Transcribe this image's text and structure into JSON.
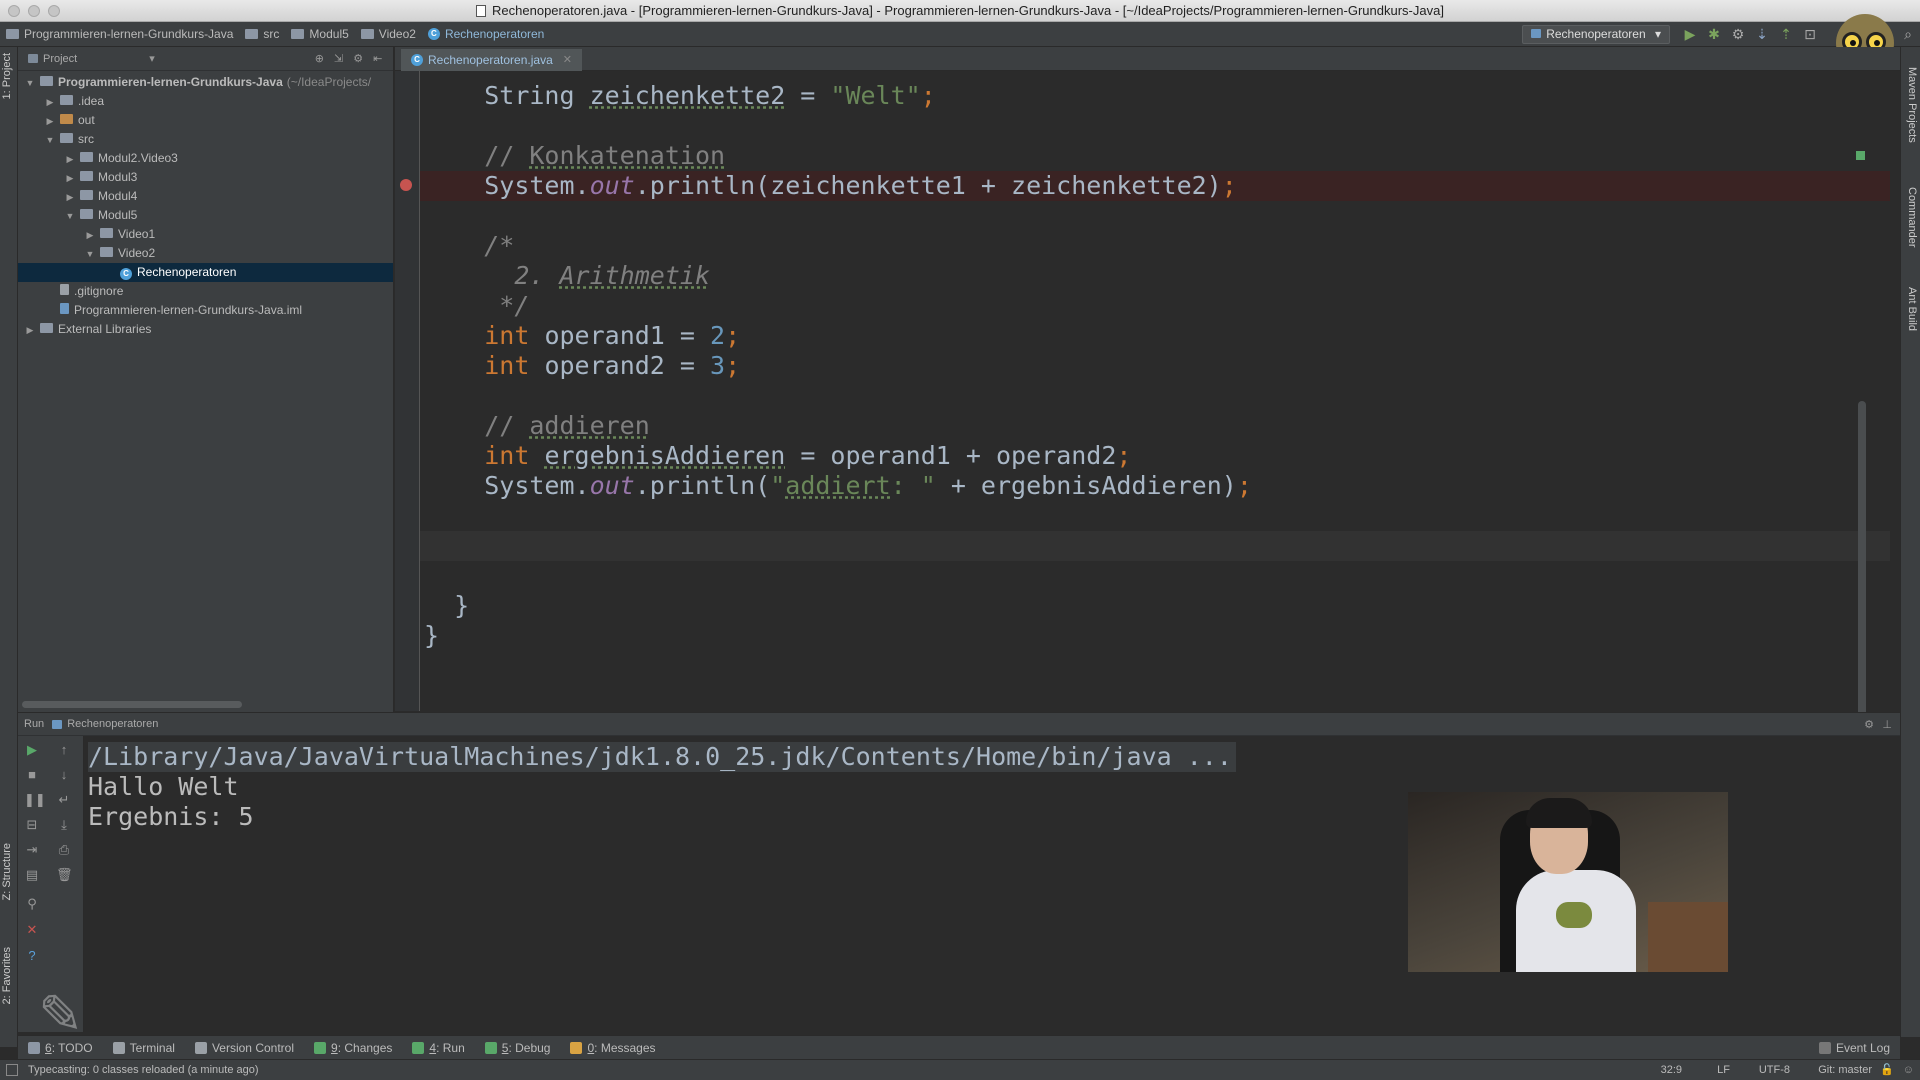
{
  "window": {
    "title": "Rechenoperatoren.java - [Programmieren-lernen-Grundkurs-Java] - Programmieren-lernen-Grundkurs-Java - [~/IdeaProjects/Programmieren-lernen-Grundkurs-Java]"
  },
  "breadcrumbs": [
    {
      "label": "Programmieren-lernen-Grundkurs-Java",
      "icon": "folder-icon"
    },
    {
      "label": "src",
      "icon": "folder-icon"
    },
    {
      "label": "Modul5",
      "icon": "folder-icon"
    },
    {
      "label": "Video2",
      "icon": "folder-icon"
    },
    {
      "label": "Rechenoperatoren",
      "icon": "class-icon"
    }
  ],
  "toolbar": {
    "run_config": "Rechenoperatoren",
    "run_config_arrow": "▾"
  },
  "left_stripe": {
    "project": "1: Project",
    "structure": "Z: Structure",
    "favorites": "2: Favorites"
  },
  "right_stripe": {
    "maven": "Maven Projects",
    "commander": "Commander",
    "ant": "Ant Build"
  },
  "project_panel": {
    "header": "Project",
    "tree": [
      {
        "label": "Programmieren-lernen-Grundkurs-Java",
        "suffix": "(~/IdeaProjects/",
        "arrow": "▼",
        "indent": 0,
        "icon": "module-icon"
      },
      {
        "label": ".idea",
        "arrow": "▶",
        "indent": 1,
        "icon": "folder-icon"
      },
      {
        "label": "out",
        "arrow": "▶",
        "indent": 1,
        "icon": "folder-orange-icon"
      },
      {
        "label": "src",
        "arrow": "▼",
        "indent": 1,
        "icon": "folder-icon"
      },
      {
        "label": "Modul2.Video3",
        "arrow": "▶",
        "indent": 2,
        "icon": "package-icon"
      },
      {
        "label": "Modul3",
        "arrow": "▶",
        "indent": 2,
        "icon": "package-icon"
      },
      {
        "label": "Modul4",
        "arrow": "▶",
        "indent": 2,
        "icon": "package-icon"
      },
      {
        "label": "Modul5",
        "arrow": "▼",
        "indent": 2,
        "icon": "package-icon"
      },
      {
        "label": "Video1",
        "arrow": "▶",
        "indent": 3,
        "icon": "package-icon"
      },
      {
        "label": "Video2",
        "arrow": "▼",
        "indent": 3,
        "icon": "package-icon"
      },
      {
        "label": "Rechenoperatoren",
        "arrow": "",
        "indent": 4,
        "icon": "class-icon",
        "selected": true
      },
      {
        "label": ".gitignore",
        "arrow": "",
        "indent": 1,
        "icon": "file-icon"
      },
      {
        "label": "Programmieren-lernen-Grundkurs-Java.iml",
        "arrow": "",
        "indent": 1,
        "icon": "iml-icon"
      },
      {
        "label": "External Libraries",
        "arrow": "▶",
        "indent": 0,
        "icon": "library-icon"
      }
    ]
  },
  "editor": {
    "tab": "Rechenoperatoren.java",
    "lines": [
      {
        "indent": "    ",
        "tokens": [
          {
            "t": "String ",
            "c": ""
          },
          {
            "t": "zeichenkette2",
            "c": "ul"
          },
          {
            "t": " = ",
            "c": ""
          },
          {
            "t": "\"Welt\"",
            "c": "str"
          },
          {
            "t": ";",
            "c": "kw"
          }
        ]
      },
      {
        "indent": "",
        "tokens": []
      },
      {
        "indent": "    ",
        "tokens": [
          {
            "t": "// ",
            "c": "cmt"
          },
          {
            "t": "Konkatenation",
            "c": "cmt ul"
          }
        ]
      },
      {
        "indent": "    ",
        "tokens": [
          {
            "t": "System.",
            "c": ""
          },
          {
            "t": "out",
            "c": "fld"
          },
          {
            "t": ".println(zeichenkette1 + zeichenkette2)",
            "c": ""
          },
          {
            "t": ";",
            "c": "kw"
          }
        ],
        "highlight": "breakline"
      },
      {
        "indent": "",
        "tokens": []
      },
      {
        "indent": "    ",
        "tokens": [
          {
            "t": "/*",
            "c": "cmt-i"
          }
        ]
      },
      {
        "indent": "      ",
        "tokens": [
          {
            "t": "2. ",
            "c": "cmt-i"
          },
          {
            "t": "Arithmetik",
            "c": "cmt-i ul"
          }
        ]
      },
      {
        "indent": "     ",
        "tokens": [
          {
            "t": "*/",
            "c": "cmt-i"
          }
        ]
      },
      {
        "indent": "    ",
        "tokens": [
          {
            "t": "int ",
            "c": "kw"
          },
          {
            "t": "operand1 = ",
            "c": ""
          },
          {
            "t": "2",
            "c": "num"
          },
          {
            "t": ";",
            "c": "kw"
          }
        ]
      },
      {
        "indent": "    ",
        "tokens": [
          {
            "t": "int ",
            "c": "kw"
          },
          {
            "t": "operand2 = ",
            "c": ""
          },
          {
            "t": "3",
            "c": "num"
          },
          {
            "t": ";",
            "c": "kw"
          }
        ]
      },
      {
        "indent": "",
        "tokens": []
      },
      {
        "indent": "    ",
        "tokens": [
          {
            "t": "// ",
            "c": "cmt"
          },
          {
            "t": "addieren",
            "c": "cmt ul"
          }
        ]
      },
      {
        "indent": "    ",
        "tokens": [
          {
            "t": "int ",
            "c": "kw"
          },
          {
            "t": "ergebnisAddieren",
            "c": "ul"
          },
          {
            "t": " = operand1 + operand2",
            "c": ""
          },
          {
            "t": ";",
            "c": "kw"
          }
        ]
      },
      {
        "indent": "    ",
        "tokens": [
          {
            "t": "System.",
            "c": ""
          },
          {
            "t": "out",
            "c": "fld"
          },
          {
            "t": ".println(",
            "c": ""
          },
          {
            "t": "\"",
            "c": "str"
          },
          {
            "t": "addiert",
            "c": "str ul"
          },
          {
            "t": ": \"",
            "c": "str"
          },
          {
            "t": " + ergebnisAddieren)",
            "c": ""
          },
          {
            "t": ";",
            "c": "kw"
          }
        ]
      },
      {
        "indent": "",
        "tokens": []
      },
      {
        "indent": "",
        "tokens": [],
        "highlight": "currentline"
      },
      {
        "indent": "",
        "tokens": []
      },
      {
        "indent": "  ",
        "tokens": [
          {
            "t": "}",
            "c": ""
          }
        ]
      },
      {
        "indent": "",
        "tokens": [
          {
            "t": "}",
            "c": ""
          }
        ]
      }
    ]
  },
  "run_panel": {
    "label": "Run",
    "config": "Rechenoperatoren",
    "console": [
      {
        "text": "/Library/Java/JavaVirtualMachines/jdk1.8.0_25.jdk/Contents/Home/bin/java ...",
        "kind": "cmd"
      },
      {
        "text": "Hallo Welt",
        "kind": "out"
      },
      {
        "text": "Ergebnis: 5",
        "kind": "out"
      }
    ]
  },
  "bottom_tabs": [
    {
      "num": "6",
      "label": ": TODO",
      "icon": "todo-icon"
    },
    {
      "num": "",
      "label": "Terminal",
      "icon": "terminal-icon"
    },
    {
      "num": "",
      "label": "Version Control",
      "icon": "vcs-icon"
    },
    {
      "num": "9",
      "label": ": Changes",
      "icon": "changes-icon"
    },
    {
      "num": "4",
      "label": ": Run",
      "icon": "run-icon"
    },
    {
      "num": "5",
      "label": ": Debug",
      "icon": "debug-icon"
    },
    {
      "num": "0",
      "label": ": Messages",
      "icon": "messages-icon"
    }
  ],
  "event_log": "Event Log",
  "status": {
    "message": "Typecasting: 0 classes reloaded (a minute ago)",
    "position": "32:9",
    "line_sep": "LF",
    "encoding": "UTF-8",
    "vcs": "Git: master"
  },
  "colors": {
    "keyword": "#cc7832",
    "string": "#6a8759",
    "number": "#6897bb",
    "comment": "#808080",
    "field": "#9876aa",
    "breakpoint": "#c75450"
  }
}
